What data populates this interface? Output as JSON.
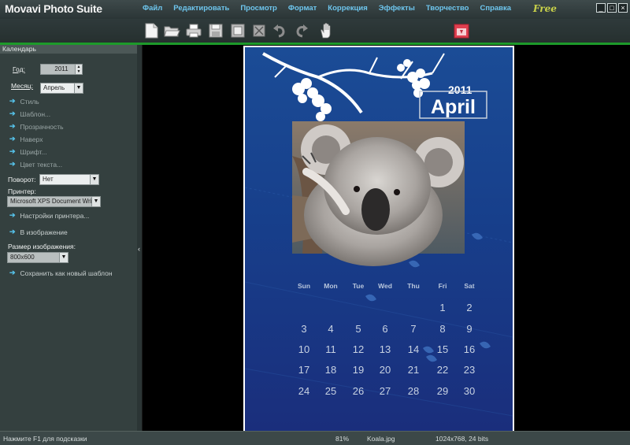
{
  "app_title": "Movavi Photo Suite",
  "menu": [
    "Файл",
    "Редактировать",
    "Просмотр",
    "Формат",
    "Коррекция",
    "Эффекты",
    "Творчество",
    "Справка"
  ],
  "free_badge": "Free",
  "toolbar_icons": [
    "new-file-icon",
    "open-folder-icon",
    "print-icon",
    "save-icon",
    "frame-icon",
    "crop-icon",
    "undo-icon",
    "redo-icon",
    "hand-icon",
    "calendar-icon"
  ],
  "sidebar": {
    "header": "Календарь",
    "year_label": "Год:",
    "year_value": "2011",
    "month_label": "Месяц:",
    "month_value": "Апрель",
    "links": [
      "Стиль",
      "Шаблон...",
      "Прозрачность",
      "Наверх",
      "Шрифт...",
      "Цвет текста..."
    ],
    "rotate_label": "Поворот:",
    "rotate_value": "Нет",
    "printer_label": "Принтер:",
    "printer_value": "Microsoft XPS Document Writ",
    "printer_settings": "Настройки принтера...",
    "to_image": "В изображение",
    "image_size_label": "Размер изображения:",
    "image_size_value": "800x600",
    "save_template": "Сохранить как новый шаблон"
  },
  "calendar": {
    "year": "2011",
    "month": "April",
    "weekdays": [
      "Sun",
      "Mon",
      "Tue",
      "Wed",
      "Thu",
      "Fri",
      "Sat"
    ],
    "weeks": [
      [
        "",
        "",
        "",
        "",
        "",
        "1",
        "2"
      ],
      [
        "3",
        "4",
        "5",
        "6",
        "7",
        "8",
        "9"
      ],
      [
        "10",
        "11",
        "12",
        "13",
        "14",
        "15",
        "16"
      ],
      [
        "17",
        "18",
        "19",
        "20",
        "21",
        "22",
        "23"
      ],
      [
        "24",
        "25",
        "26",
        "27",
        "28",
        "29",
        "30"
      ]
    ]
  },
  "status": {
    "hint": "Нажмите F1 для подсказки",
    "zoom": "81%",
    "file": "Koala.jpg",
    "info": "1024x768, 24 bits"
  }
}
